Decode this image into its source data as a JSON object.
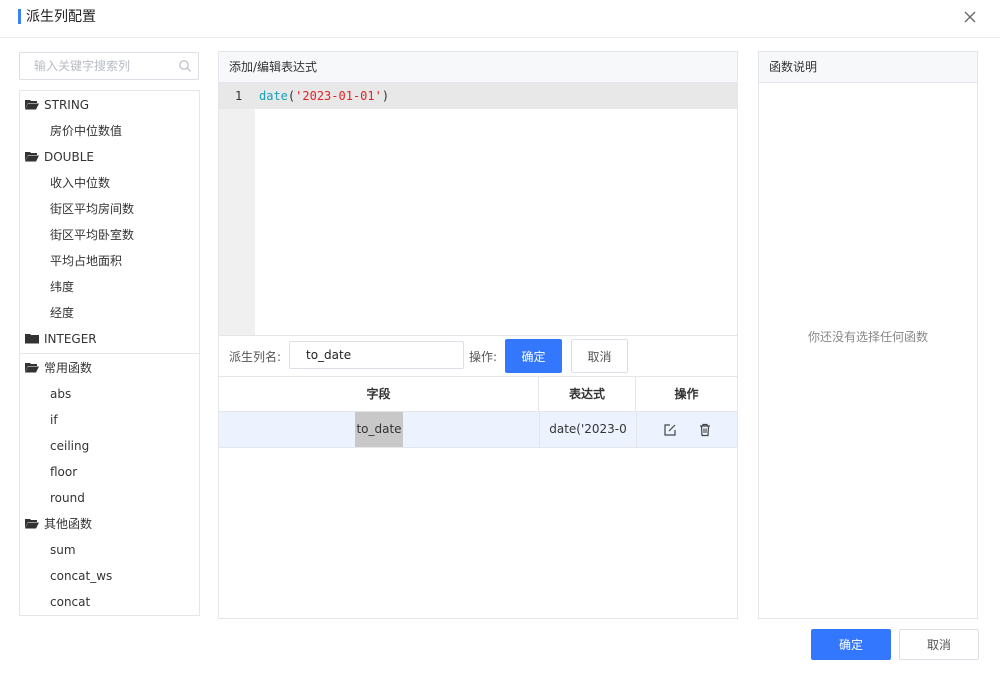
{
  "dialog": {
    "title": "派生列配置",
    "accent_color": "#3b82f6"
  },
  "search": {
    "placeholder": "输入关键字搜索列"
  },
  "tree": {
    "groups": [
      {
        "label": "STRING",
        "items": [
          "房价中位数值"
        ]
      },
      {
        "label": "DOUBLE",
        "items": [
          "收入中位数",
          "街区平均房间数",
          "街区平均卧室数",
          "平均占地面积",
          "纬度",
          "经度"
        ]
      },
      {
        "label": "INTEGER",
        "items": []
      },
      {
        "label": "常用函数",
        "items": [
          "abs",
          "if",
          "ceiling",
          "floor",
          "round"
        ]
      },
      {
        "label": "其他函数",
        "items": [
          "sum",
          "concat_ws",
          "concat"
        ]
      }
    ]
  },
  "editor": {
    "header": "添加/编辑表达式",
    "line_number": "1",
    "code_fn": "date",
    "code_open": "(",
    "code_str": "'2023-01-01'",
    "code_close": ")"
  },
  "derived": {
    "name_label": "派生列名:",
    "name_value": "to_date",
    "op_label": "操作:",
    "confirm_label": "确定",
    "cancel_label": "取消"
  },
  "table": {
    "headers": [
      "字段",
      "表达式",
      "操作"
    ],
    "rows": [
      {
        "field": "to_date",
        "expression": "date('2023-0"
      }
    ]
  },
  "functions_panel": {
    "header": "函数说明",
    "empty_tip": "你还没有选择任何函数"
  },
  "footer": {
    "ok_label": "确定",
    "cancel_label": "取消",
    "primary_color": "#3377ff"
  }
}
